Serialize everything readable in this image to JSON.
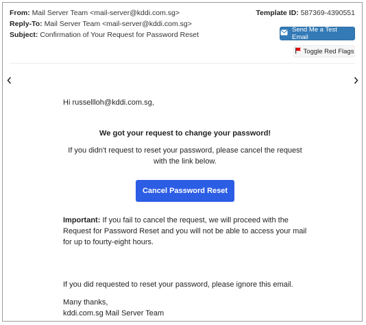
{
  "header": {
    "from_label": "From:",
    "from_value": "Mail Server Team <mail-server@kddi.com.sg>",
    "reply_label": "Reply-To:",
    "reply_value": "Mail Server Team <mail-server@kddi.com.sg>",
    "subject_label": "Subject:",
    "subject_value": "Confirmation of Your Request for Password Reset",
    "template_label": "Template ID:",
    "template_value": "587369-4390551"
  },
  "actions": {
    "send_test_label": "Send Me a Test Email",
    "toggle_flags_label": "Toggle Red Flags"
  },
  "email": {
    "greeting": "Hi russellloh@kddi.com.sg,",
    "headline": "We got your request to change your password!",
    "request_text": "If you didn't request to reset your password, please cancel the request with the link below.",
    "cancel_button": "Cancel Password Reset",
    "important_label": "Important:",
    "important_text": " If you fail to cancel the request, we will proceed with the Request for Password Reset and you will not be able to access your mail for up to fourty-eight hours.",
    "ignore_text": "If you did requested to reset your password, please ignore this email.",
    "thanks_line1": "Many thanks,",
    "thanks_line2": "kddi.com.sg Mail Server Team"
  },
  "icons": {
    "send": "envelope-icon",
    "flag": "flag-icon",
    "prev": "chevron-left-icon",
    "next": "chevron-right-icon"
  },
  "colors": {
    "send_button": "#337ab7",
    "cancel_button": "#2c5de5",
    "flag": "#e00000"
  }
}
